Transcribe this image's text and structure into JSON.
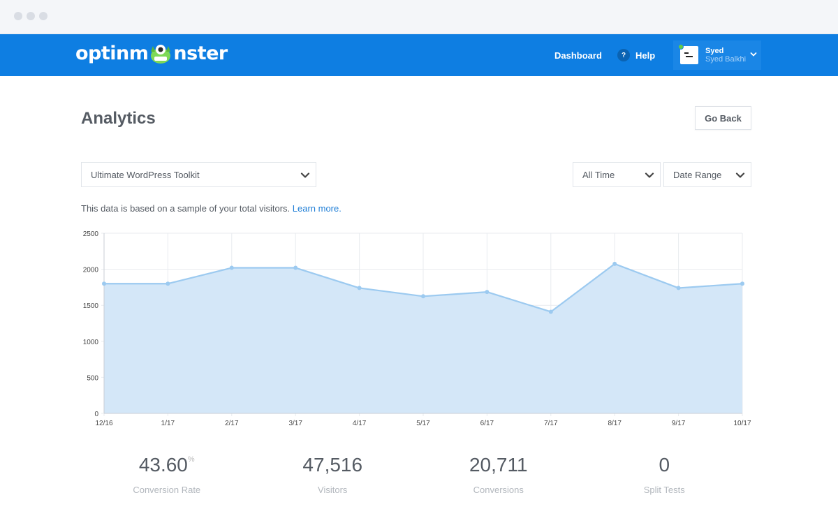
{
  "window": {
    "controls": [
      "close",
      "minimize",
      "zoom"
    ]
  },
  "navbar": {
    "logo_text_left": "optinm",
    "logo_text_right": "nster",
    "dashboard_label": "Dashboard",
    "help_icon_glyph": "?",
    "help_label": "Help",
    "user": {
      "name": "Syed",
      "full_name": "Syed Balkhi",
      "status": "online"
    }
  },
  "page": {
    "title": "Analytics",
    "go_back_label": "Go Back"
  },
  "filters": {
    "campaign": "Ultimate WordPress Toolkit",
    "time": "All Time",
    "range": "Date Range"
  },
  "note": {
    "text": "This data is based on a sample of your total visitors. ",
    "link": "Learn more."
  },
  "chart_data": {
    "type": "area",
    "categories": [
      "12/16",
      "1/17",
      "2/17",
      "3/17",
      "4/17",
      "5/17",
      "6/17",
      "7/17",
      "8/17",
      "9/17",
      "10/17"
    ],
    "values": [
      1800,
      1800,
      2020,
      2020,
      1740,
      1625,
      1685,
      1410,
      2075,
      1740,
      1800
    ],
    "ylim": [
      0,
      2500
    ],
    "yticks": [
      0,
      500,
      1000,
      1500,
      2000,
      2500
    ],
    "grid": true,
    "colors": {
      "line": "#9ccaf0",
      "fill": "#d4e7f8",
      "grid": "#e8ebef",
      "axis": "#c9ced4"
    }
  },
  "stats": [
    {
      "value": "43.60",
      "suffix": "%",
      "label": "Conversion Rate"
    },
    {
      "value": "47,516",
      "label": "Visitors"
    },
    {
      "value": "20,711",
      "label": "Conversions"
    },
    {
      "value": "0",
      "label": "Split Tests"
    }
  ],
  "colors": {
    "brand": "#0e7ee2",
    "link": "#1f7ed6"
  }
}
